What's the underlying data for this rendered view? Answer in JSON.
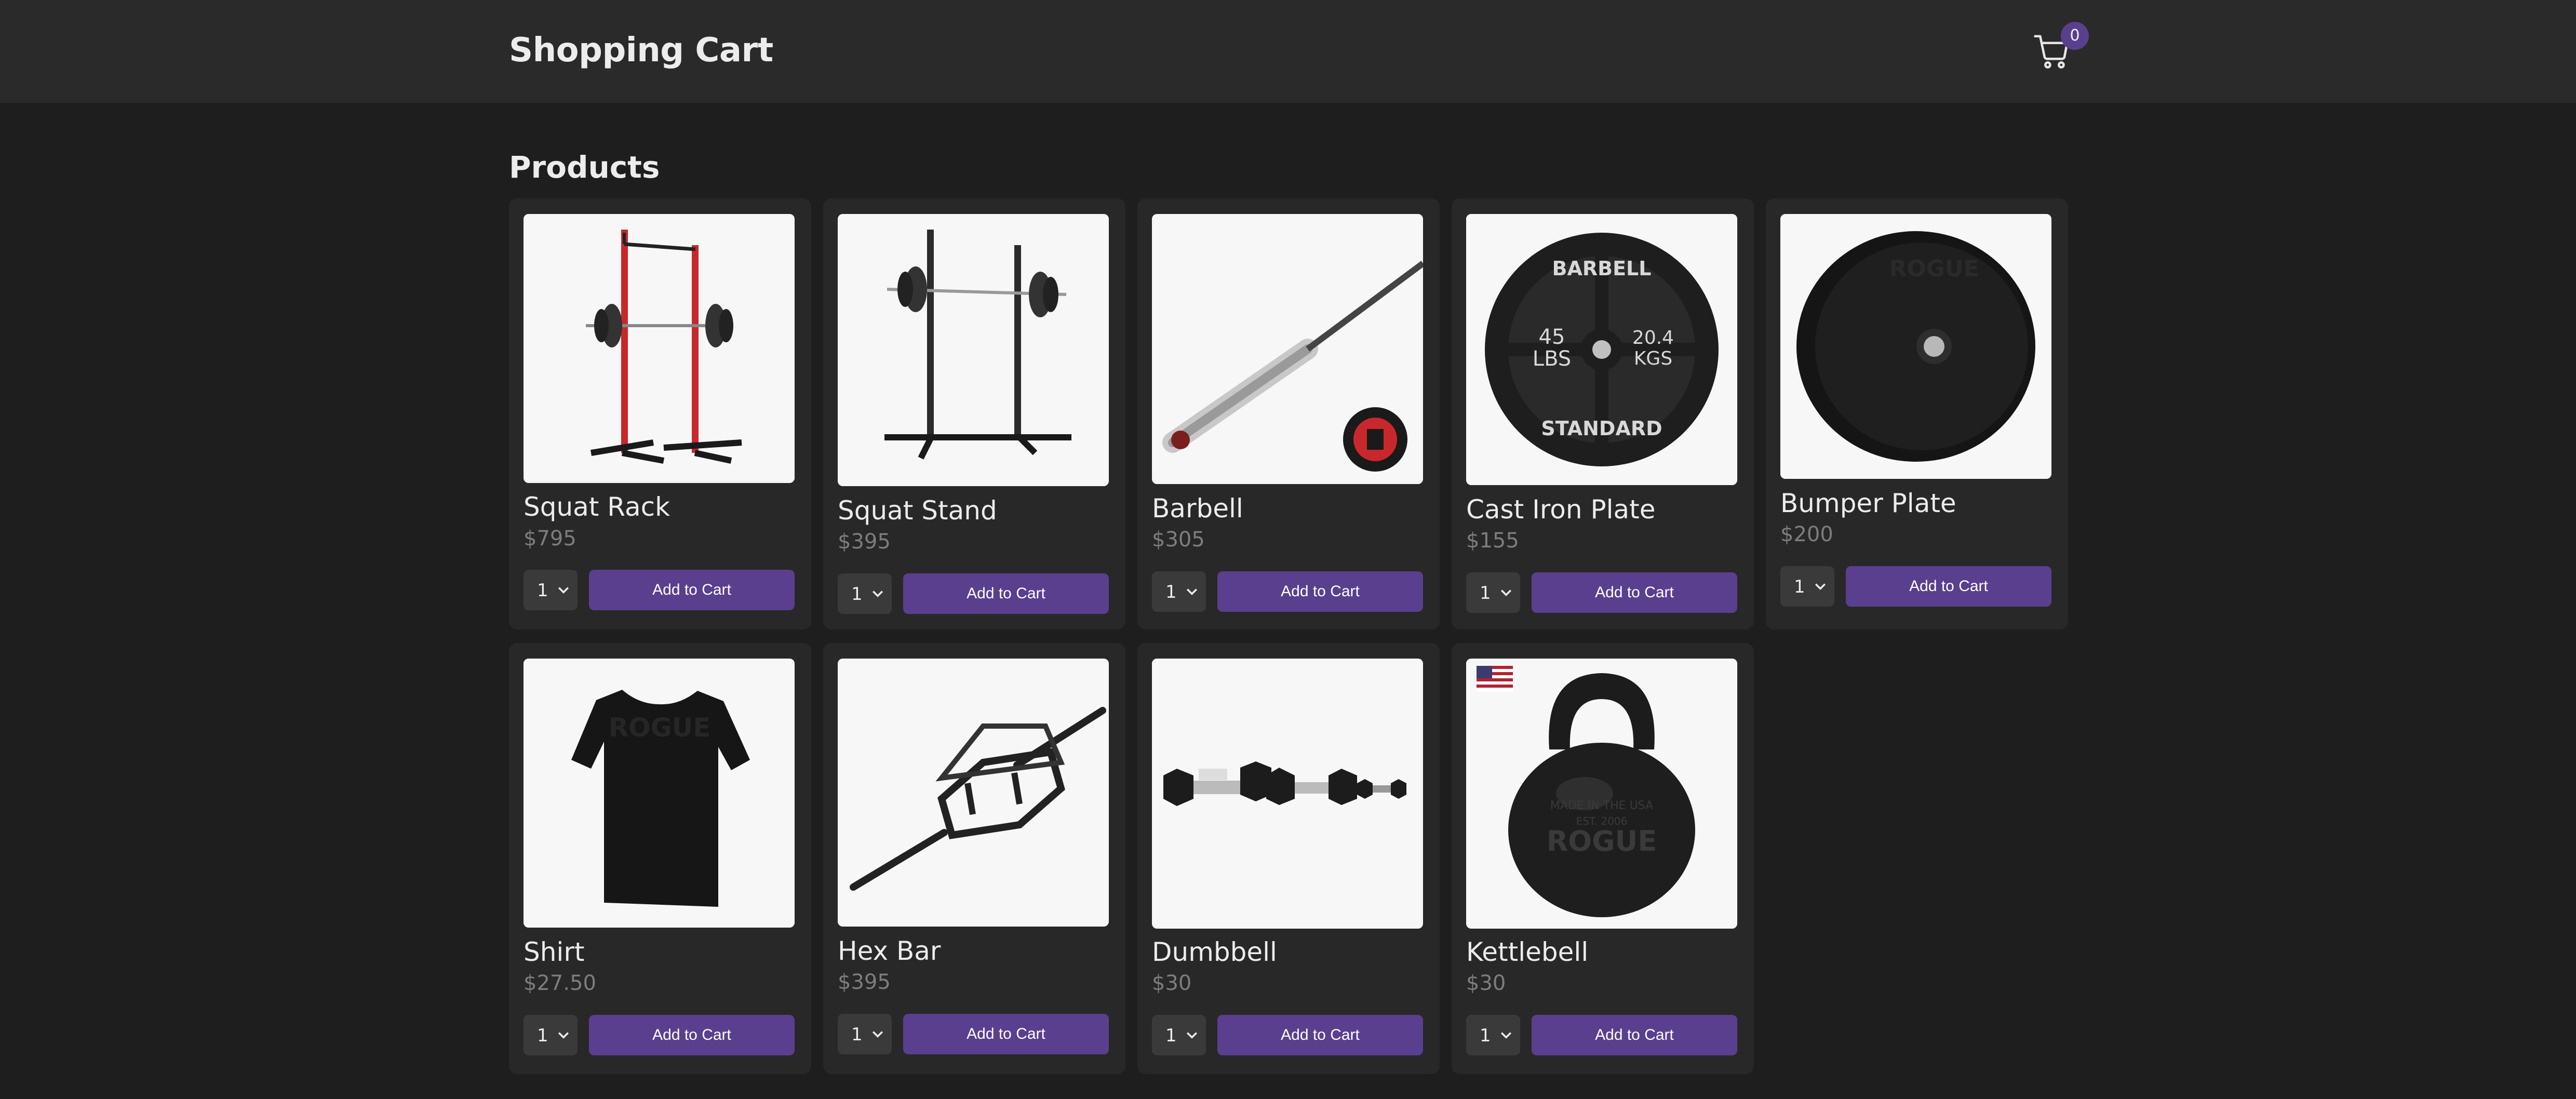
{
  "header": {
    "title": "Shopping Cart",
    "cart_icon": "cart-icon",
    "cart_count": "0"
  },
  "section_title": "Products",
  "products": [
    {
      "name": "Squat Rack",
      "price": "$795",
      "qty": "1",
      "button": "Add to Cart"
    },
    {
      "name": "Squat Stand",
      "price": "$395",
      "qty": "1",
      "button": "Add to Cart"
    },
    {
      "name": "Barbell",
      "price": "$305",
      "qty": "1",
      "button": "Add to Cart"
    },
    {
      "name": "Cast Iron Plate",
      "price": "$155",
      "qty": "1",
      "button": "Add to Cart"
    },
    {
      "name": "Bumper Plate",
      "price": "$200",
      "qty": "1",
      "button": "Add to Cart"
    },
    {
      "name": "Shirt",
      "price": "$27.50",
      "qty": "1",
      "button": "Add to Cart"
    },
    {
      "name": "Hex Bar",
      "price": "$395",
      "qty": "1",
      "button": "Add to Cart"
    },
    {
      "name": "Dumbbell",
      "price": "$30",
      "qty": "1",
      "button": "Add to Cart"
    },
    {
      "name": "Kettlebell",
      "price": "$30",
      "qty": "1",
      "button": "Add to Cart"
    }
  ],
  "image_text": {
    "plate_top": "BARBELL",
    "plate_bottom": "STANDARD",
    "plate_left_1": "45",
    "plate_left_2": "LBS",
    "plate_right_1": "20.4",
    "plate_right_2": "KGS",
    "brand": "ROGUE",
    "kb_line1": "MADE IN THE USA",
    "kb_line2": "EST. 2006"
  },
  "colors": {
    "accent": "#5a3f8f",
    "header_bg": "#2a2a2a",
    "page_bg": "#1e1e1e",
    "card_bg": "#282828"
  }
}
